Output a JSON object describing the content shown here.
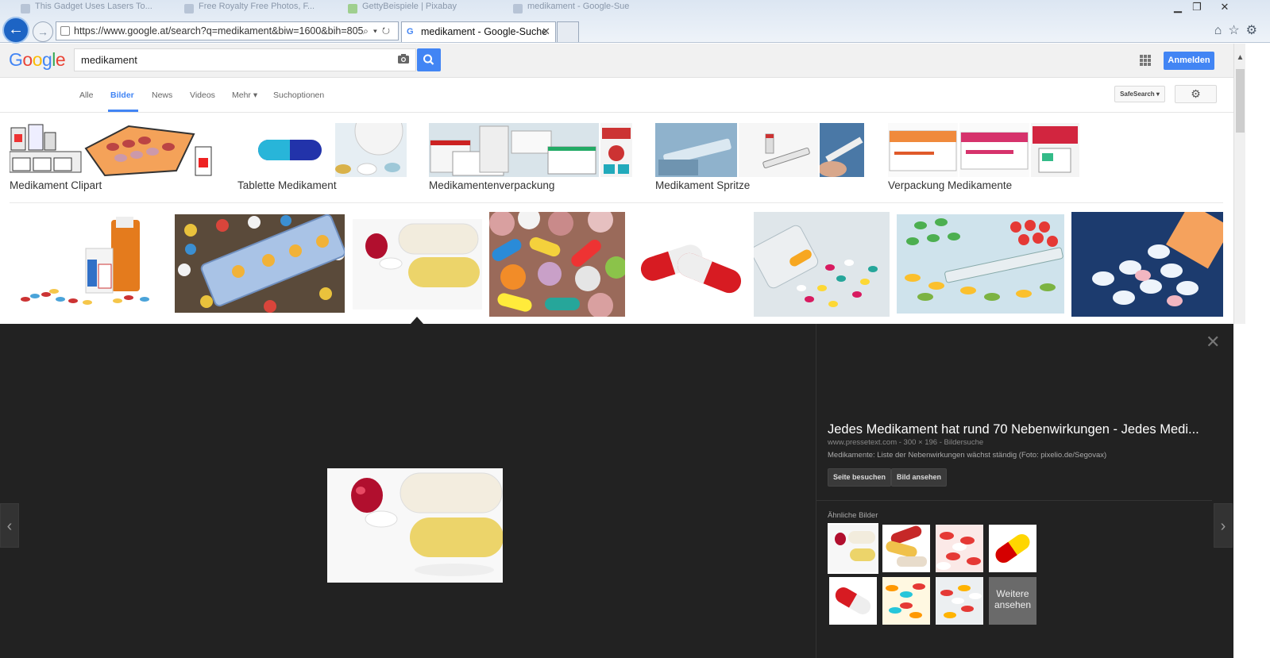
{
  "browser": {
    "background_tabs": [
      "This Gadget Uses Lasers To...",
      "Free Royalty Free Photos, F...",
      "GettyBeispiele | Pixabay",
      "medikament - Google-Sue"
    ],
    "address_url": "https://www.google.at/search?q=medikament&biw=1600&bih=805",
    "active_tab_title": "medikament - Google-Suche",
    "window_controls": [
      "minimize-icon",
      "restore-icon",
      "close-icon"
    ],
    "toolbar_icons": [
      "home-icon",
      "star-icon",
      "gear-icon"
    ]
  },
  "google": {
    "logo": "Google",
    "query": "medikament",
    "signin_label": "Anmelden"
  },
  "nav": {
    "tabs": [
      "Alle",
      "Bilder",
      "News",
      "Videos",
      "Mehr ▾",
      "Suchoptionen"
    ],
    "active_tab": "Bilder",
    "safesearch_label": "SafeSearch ▾"
  },
  "related": [
    {
      "label": "Medikament Clipart"
    },
    {
      "label": "Tablette Medikament"
    },
    {
      "label": "Medikamentenverpackung"
    },
    {
      "label": "Medikament Spritze"
    },
    {
      "label": "Verpackung Medikamente"
    }
  ],
  "preview": {
    "title": "Jedes Medikament hat rund 70 Nebenwirkungen - Jedes Medi...",
    "meta": "www.pressetext.com - 300 × 196 - Bildersuche",
    "description": "Medikamente: Liste der Nebenwirkungen wächst ständig (Foto: pixelio.de/Segovax)",
    "visit_label": "Seite besuchen",
    "view_label": "Bild ansehen",
    "similar_label": "Ähnliche Bilder",
    "more_label": "Weitere ansehen"
  },
  "colors": {
    "accent": "#4285f4",
    "panel_bg": "#222222"
  }
}
